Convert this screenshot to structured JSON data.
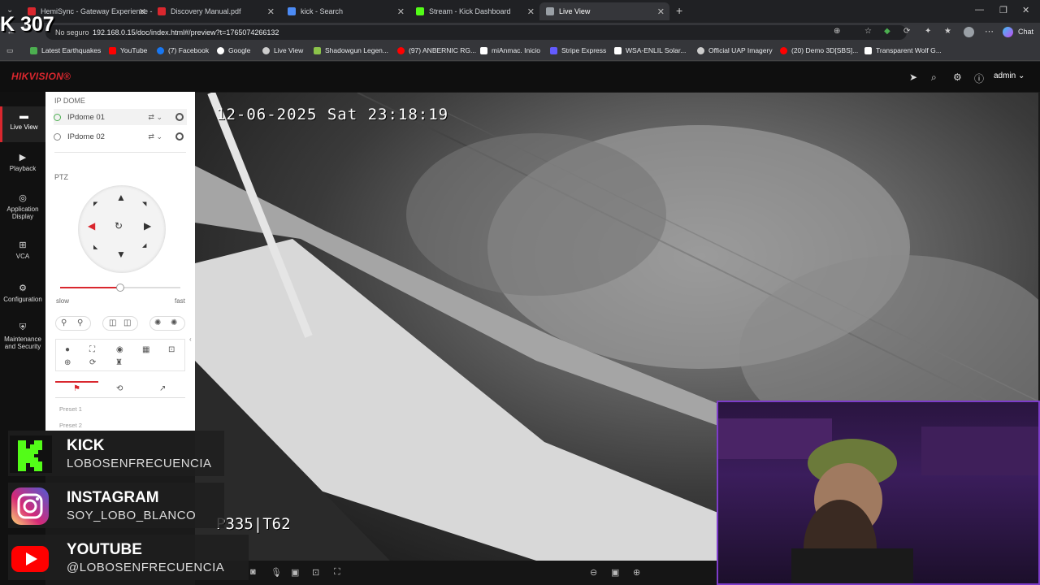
{
  "stream_overlay": {
    "corner_logo_text": "K 307",
    "socials": [
      {
        "title": "KICK",
        "handle": "LOBOSENFRECUENCIA"
      },
      {
        "title": "INSTAGRAM",
        "handle": "SOY_LOBO_BLANCO"
      },
      {
        "title": "YOUTUBE",
        "handle": "@LOBOSENFRECUENCIA"
      }
    ]
  },
  "browser": {
    "tabs": [
      {
        "label": "HemiSync - Gateway Experience -",
        "color": "#d9272e"
      },
      {
        "label": "Discovery Manual.pdf",
        "color": "#d9272e"
      },
      {
        "label": "kick - Search",
        "color": "#4c8bf5"
      },
      {
        "label": "Stream - Kick Dashboard",
        "color": "#53fc18"
      },
      {
        "label": "Live View",
        "color": "#9aa0a6"
      }
    ],
    "new_tab": "+",
    "url_security": "No seguro",
    "url": "192.168.0.15/doc/index.html#/preview?t=1765074266132",
    "chat_label": "Chat",
    "bookmarks": [
      {
        "label": "Latest Earthquakes",
        "color": "#4caf50"
      },
      {
        "label": "YouTube",
        "color": "#ff0000"
      },
      {
        "label": "(7) Facebook",
        "color": "#1877f2"
      },
      {
        "label": "Google",
        "color": "#ffffff"
      },
      {
        "label": "Live View",
        "color": "#cccccc"
      },
      {
        "label": "Shadowgun Legen...",
        "color": "#8bc34a"
      },
      {
        "label": "(97) ANBERNIC RG...",
        "color": "#ff0000"
      },
      {
        "label": "miAnmac. Inicio",
        "color": "#ffffff"
      },
      {
        "label": "Stripe Express",
        "color": "#635bff"
      },
      {
        "label": "WSA-ENLIL Solar...",
        "color": "#ffffff"
      },
      {
        "label": "Official UAP Imagery",
        "color": "#cccccc"
      },
      {
        "label": "(20) Demo 3D[SBS]...",
        "color": "#ff0000"
      },
      {
        "label": "Transparent Wolf G...",
        "color": "#ffffff"
      }
    ]
  },
  "app": {
    "brand": "HIKVISION®",
    "user": "admin",
    "nav": [
      {
        "label": "Live View",
        "icon": "monitor-icon"
      },
      {
        "label": "Playback",
        "icon": "playback-icon"
      },
      {
        "label": "Application Display",
        "icon": "application-icon"
      },
      {
        "label": "VCA",
        "icon": "vca-icon"
      },
      {
        "label": "Configuration",
        "icon": "gear-icon"
      },
      {
        "label": "Maintenance and Security",
        "icon": "shield-icon"
      }
    ],
    "camera_group": "IP DOME",
    "cameras": [
      "IPdome 01",
      "IPdome 02"
    ],
    "ptz_heading": "PTZ",
    "speed": {
      "slow": "slow",
      "fast": "fast",
      "level": 0.5
    },
    "presets": [
      "Preset 1",
      "Preset 2"
    ]
  },
  "video": {
    "timestamp": "12-06-2025 Sat 23:18:19",
    "ptz_position": "P335|T62"
  }
}
